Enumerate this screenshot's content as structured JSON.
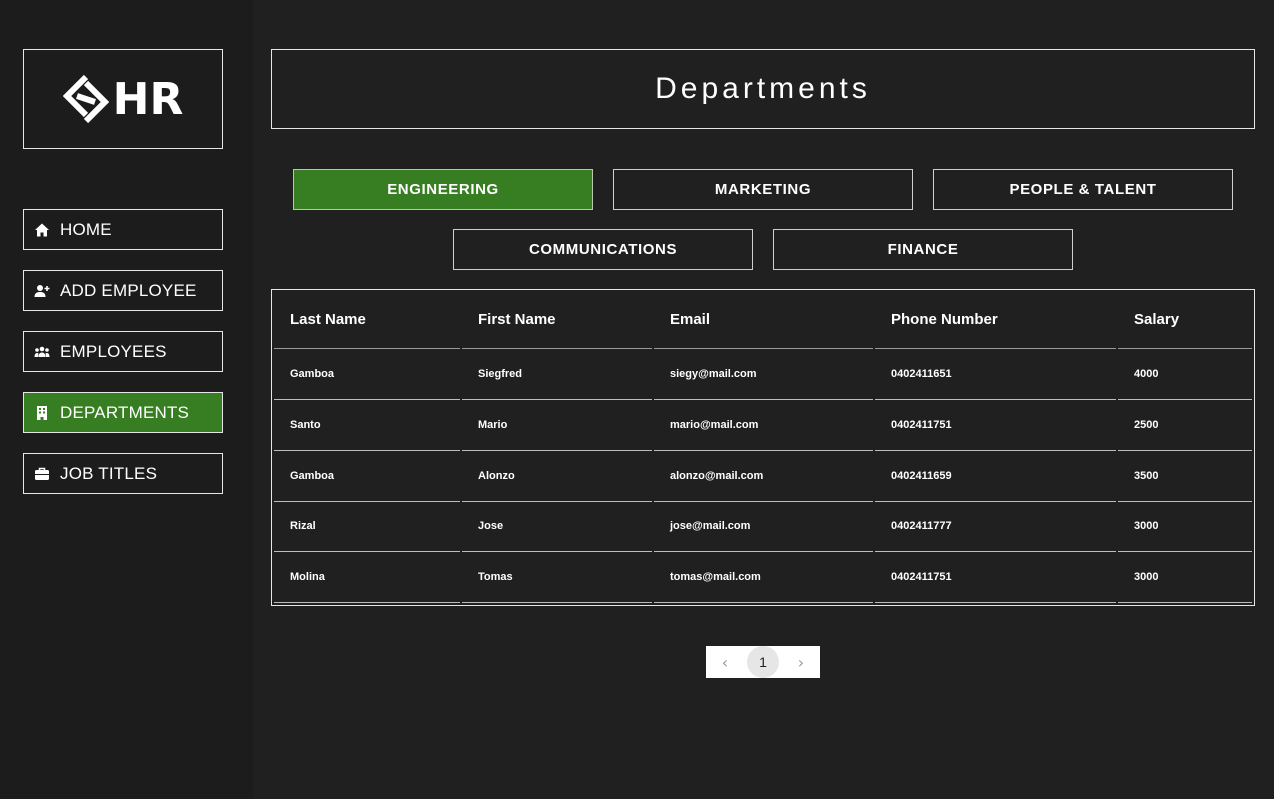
{
  "app": {
    "logo_text": "HR",
    "accent_color": "#377e22",
    "background_color": "#202020"
  },
  "sidebar": {
    "items": [
      {
        "label": "HOME",
        "icon": "home-icon",
        "active": false
      },
      {
        "label": "ADD EMPLOYEE",
        "icon": "add-user-icon",
        "active": false
      },
      {
        "label": "EMPLOYEES",
        "icon": "group-icon",
        "active": false
      },
      {
        "label": "DEPARTMENTS",
        "icon": "building-icon",
        "active": true
      },
      {
        "label": "JOB TITLES",
        "icon": "briefcase-icon",
        "active": false
      }
    ]
  },
  "main": {
    "title": "Departments",
    "tabs": [
      {
        "label": "ENGINEERING",
        "active": true
      },
      {
        "label": "MARKETING",
        "active": false
      },
      {
        "label": "PEOPLE & TALENT",
        "active": false
      },
      {
        "label": "COMMUNICATIONS",
        "active": false
      },
      {
        "label": "FINANCE",
        "active": false
      }
    ],
    "table": {
      "columns": [
        "Last Name",
        "First Name",
        "Email",
        "Phone Number",
        "Salary"
      ],
      "rows": [
        [
          "Gamboa",
          "Siegfred",
          "siegy@mail.com",
          "0402411651",
          "4000"
        ],
        [
          "Santo",
          "Mario",
          "mario@mail.com",
          "0402411751",
          "2500"
        ],
        [
          "Gamboa",
          "Alonzo",
          "alonzo@mail.com",
          "0402411659",
          "3500"
        ],
        [
          "Rizal",
          "Jose",
          "jose@mail.com",
          "0402411777",
          "3000"
        ],
        [
          "Molina",
          "Tomas",
          "tomas@mail.com",
          "0402411751",
          "3000"
        ]
      ]
    },
    "pagination": {
      "prev_icon": "chevron-left-icon",
      "current_page": "1",
      "next_icon": "chevron-right-icon"
    }
  }
}
